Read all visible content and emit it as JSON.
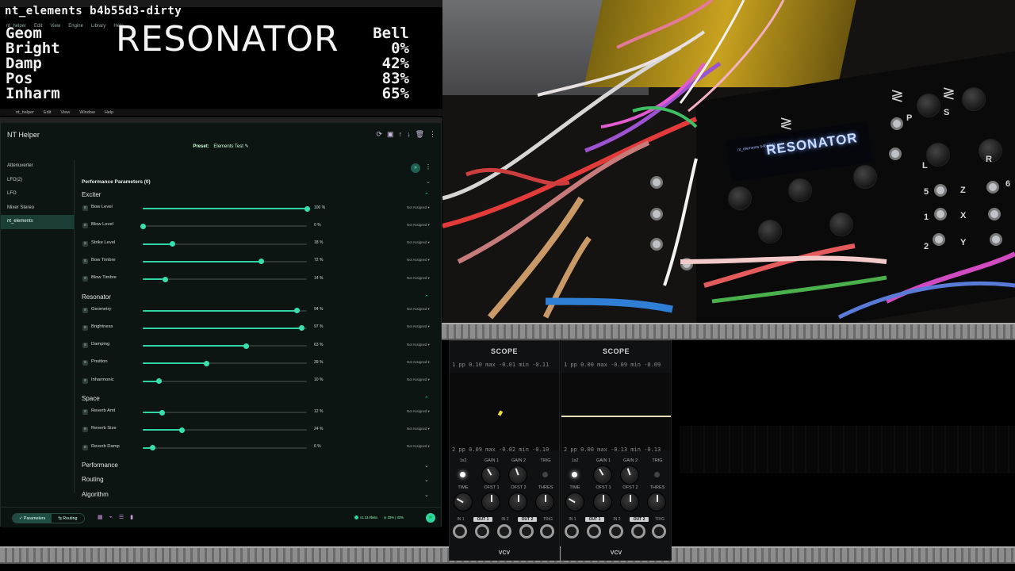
{
  "oled": {
    "window_title": "nt_elements b4b55d3-dirty",
    "app_menu": [
      "nt_helper",
      "Edit",
      "View",
      "Engine",
      "Library",
      "Help"
    ],
    "algorithm_name": "RESONATOR",
    "params": [
      {
        "label": "Geom",
        "value": "Bell"
      },
      {
        "label": "Bright",
        "value": "0%"
      },
      {
        "label": "Damp",
        "value": "42%"
      },
      {
        "label": "Pos",
        "value": "83%"
      },
      {
        "label": "Inharm",
        "value": "65%"
      }
    ],
    "system_menu": [
      "nt_helper",
      "Edit",
      "View",
      "Window",
      "Help"
    ]
  },
  "helper": {
    "title": "NT Helper",
    "preset_label": "Preset:",
    "preset_name": "Elements Test",
    "sidebar": [
      "Attenuverter",
      "LFO(2)",
      "LFO",
      "Mixer Stereo",
      "nt_elements"
    ],
    "active_sidebar": "nt_elements",
    "performance_title": "Performance Parameters (0)",
    "assign_label": "Not Assigned",
    "sections": [
      {
        "name": "Exciter",
        "expanded": true,
        "params": [
          {
            "name": "Bow Level",
            "value": 100,
            "display": "100 %"
          },
          {
            "name": "Blow Level",
            "value": 0,
            "display": "0 %"
          },
          {
            "name": "Strike Level",
            "value": 18,
            "display": "18 %"
          },
          {
            "name": "Bow Timbre",
            "value": 72,
            "display": "72 %"
          },
          {
            "name": "Blow Timbre",
            "value": 14,
            "display": "14 %"
          }
        ]
      },
      {
        "name": "Resonator",
        "expanded": true,
        "params": [
          {
            "name": "Geometry",
            "value": 94,
            "display": "94 %"
          },
          {
            "name": "Brightness",
            "value": 97,
            "display": "97 %"
          },
          {
            "name": "Damping",
            "value": 63,
            "display": "63 %"
          },
          {
            "name": "Position",
            "value": 39,
            "display": "39 %"
          },
          {
            "name": "Inharmonic",
            "value": 10,
            "display": "10 %"
          }
        ]
      },
      {
        "name": "Space",
        "expanded": true,
        "params": [
          {
            "name": "Reverb Amt",
            "value": 12,
            "display": "12 %"
          },
          {
            "name": "Reverb Size",
            "value": 24,
            "display": "24 %"
          },
          {
            "name": "Reverb Damp",
            "value": 6,
            "display": "6 %"
          }
        ]
      },
      {
        "name": "Performance",
        "expanded": false,
        "params": []
      },
      {
        "name": "Routing",
        "expanded": false,
        "params": []
      },
      {
        "name": "Algorithm",
        "expanded": false,
        "params": []
      }
    ],
    "bottom_tabs": [
      "Parameters",
      "Routing"
    ],
    "active_tab": "Parameters",
    "status_version": "v1.13.0beta",
    "status_cpu": "33% | 32%"
  },
  "photo": {
    "display_title": "RESONATOR",
    "display_sub": "nt_elements b4b55d3",
    "panel_labels": [
      "P",
      "S",
      "L",
      "R",
      "Z",
      "X",
      "Y",
      "5",
      "6",
      "1",
      "2",
      "1"
    ]
  },
  "scopes": [
    {
      "title": "SCOPE",
      "ch1_stats": "1 pp  0.10 max -0.01 min -0.11",
      "ch2_stats": "2 pp  0.09 max -0.02 min -0.10",
      "knobs_row1": [
        "1x2",
        "GAIN 1",
        "GAIN 2",
        "TRIG"
      ],
      "knobs_row2": [
        "TIME",
        "OFST 1",
        "OFST 2",
        "THRES"
      ],
      "jacks": [
        "IN 1",
        "OUT 1",
        "IN 2",
        "OUT 2",
        "TRIG"
      ],
      "brand": "VCV"
    },
    {
      "title": "SCOPE",
      "ch1_stats": "1 pp  0.00 max -0.09 min -0.09",
      "ch2_stats": "2 pp  0.00 max -0.13 min -0.13",
      "knobs_row1": [
        "1x2",
        "GAIN 1",
        "GAIN 2",
        "TRIG"
      ],
      "knobs_row2": [
        "TIME",
        "OFST 1",
        "OFST 2",
        "THRES"
      ],
      "jacks": [
        "IN 1",
        "OUT 1",
        "IN 2",
        "OUT 2",
        "TRIG"
      ],
      "brand": "VCV"
    }
  ],
  "colors": {
    "accent": "#2fd6a3",
    "panel_bg": "#0d1513",
    "active_nav": "#1a3d36"
  }
}
